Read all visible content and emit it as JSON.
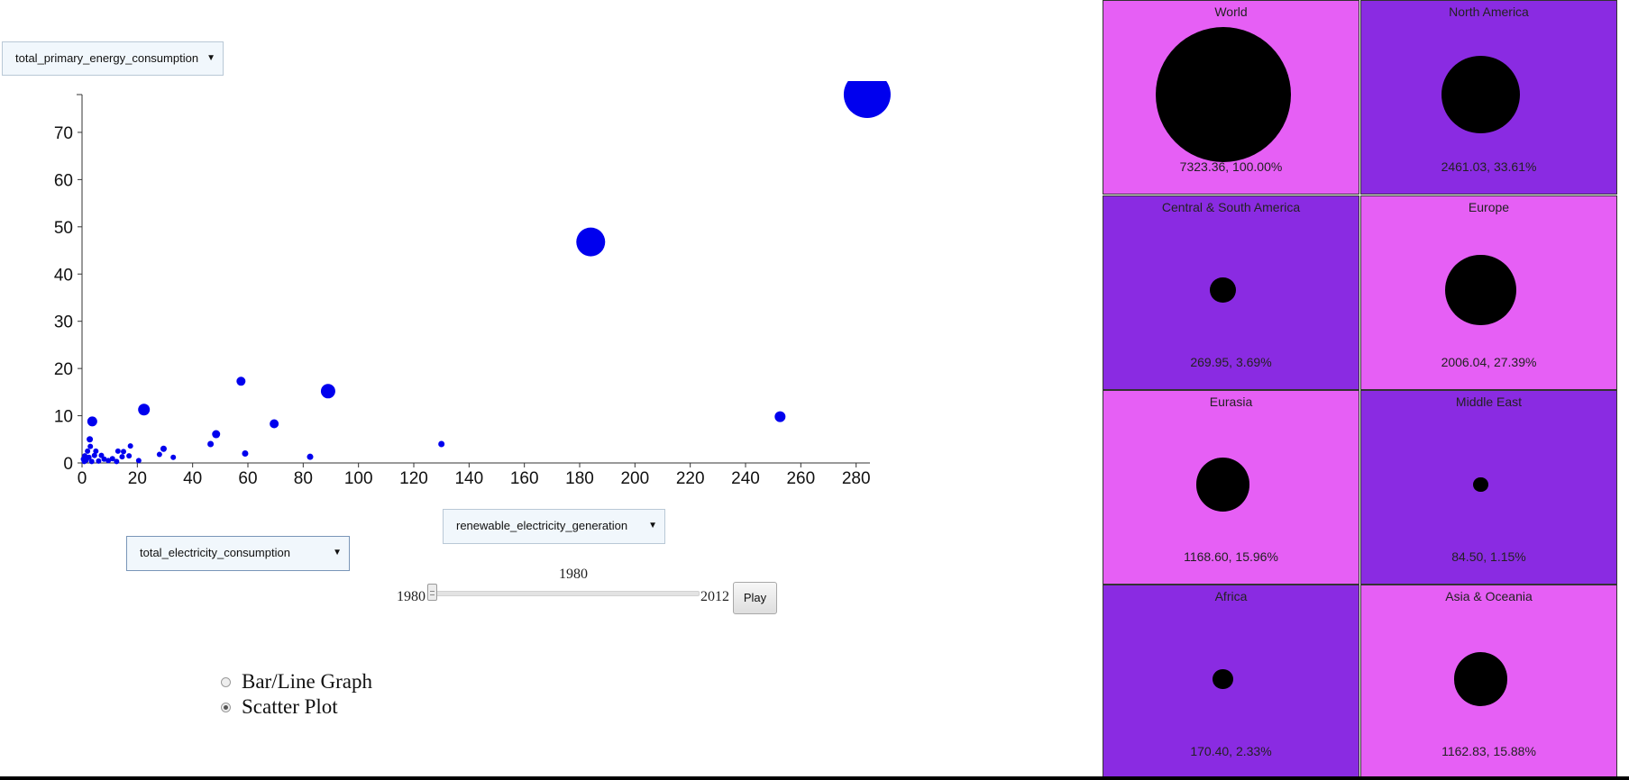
{
  "controls": {
    "y_select": "total_primary_energy_consumption",
    "size_select": "renewable_electricity_generation",
    "x_select": "total_electricity_consumption",
    "year_current": "1980",
    "year_min": "1980",
    "year_max": "2012",
    "play_label": "Play",
    "radio_bar_label": "Bar/Line Graph",
    "radio_scatter_label": "Scatter Plot",
    "selected_view": "scatter"
  },
  "chart_data": {
    "type": "scatter",
    "title": "",
    "xlabel": "",
    "ylabel": "",
    "xlim": [
      0,
      285
    ],
    "ylim": [
      0,
      78
    ],
    "xticks": [
      0,
      20,
      40,
      60,
      80,
      100,
      120,
      140,
      160,
      180,
      200,
      220,
      240,
      260,
      280
    ],
    "yticks": [
      0,
      10,
      20,
      30,
      40,
      50,
      60,
      70
    ],
    "grid": false,
    "point_color": "#0000ee",
    "points": [
      {
        "x": 284,
        "y": 78,
        "size": 26
      },
      {
        "x": 184,
        "y": 46.8,
        "size": 16
      },
      {
        "x": 252.5,
        "y": 9.8,
        "size": 6
      },
      {
        "x": 89,
        "y": 15.2,
        "size": 8
      },
      {
        "x": 57.5,
        "y": 17.3,
        "size": 5
      },
      {
        "x": 22.4,
        "y": 11.3,
        "size": 6.5
      },
      {
        "x": 69.5,
        "y": 8.3,
        "size": 5
      },
      {
        "x": 3.7,
        "y": 8.8,
        "size": 5.5
      },
      {
        "x": 48.5,
        "y": 6.1,
        "size": 4.5
      },
      {
        "x": 46.5,
        "y": 4,
        "size": 3.5
      },
      {
        "x": 130,
        "y": 4,
        "size": 3.5
      },
      {
        "x": 59,
        "y": 2,
        "size": 3.5
      },
      {
        "x": 82.5,
        "y": 1.3,
        "size": 3.5
      },
      {
        "x": 29.5,
        "y": 3,
        "size": 3.5
      },
      {
        "x": 28,
        "y": 1.8,
        "size": 3
      },
      {
        "x": 33,
        "y": 1.2,
        "size": 3
      },
      {
        "x": 17.5,
        "y": 3.6,
        "size": 3
      },
      {
        "x": 17,
        "y": 1.5,
        "size": 3
      },
      {
        "x": 13,
        "y": 2.5,
        "size": 3
      },
      {
        "x": 14.5,
        "y": 1.3,
        "size": 3
      },
      {
        "x": 11,
        "y": 0.9,
        "size": 3
      },
      {
        "x": 9.5,
        "y": 0.5,
        "size": 3
      },
      {
        "x": 8,
        "y": 0.8,
        "size": 3
      },
      {
        "x": 6,
        "y": 0.4,
        "size": 3
      },
      {
        "x": 5,
        "y": 2.5,
        "size": 3
      },
      {
        "x": 4.5,
        "y": 1.6,
        "size": 3
      },
      {
        "x": 3,
        "y": 3.5,
        "size": 3
      },
      {
        "x": 2.8,
        "y": 5,
        "size": 3.5
      },
      {
        "x": 2.5,
        "y": 1.2,
        "size": 3
      },
      {
        "x": 2,
        "y": 2.5,
        "size": 3
      },
      {
        "x": 1.5,
        "y": 0.6,
        "size": 3
      },
      {
        "x": 1,
        "y": 1.5,
        "size": 3
      },
      {
        "x": 0.8,
        "y": 0.3,
        "size": 3
      },
      {
        "x": 0.5,
        "y": 0.8,
        "size": 3
      },
      {
        "x": 3.5,
        "y": 0.3,
        "size": 3
      },
      {
        "x": 12.5,
        "y": 0.3,
        "size": 3
      },
      {
        "x": 20.5,
        "y": 0.5,
        "size": 3
      },
      {
        "x": 7,
        "y": 1.6,
        "size": 3
      },
      {
        "x": 15,
        "y": 2.4,
        "size": 3
      }
    ]
  },
  "regions": {
    "max_radius": 75,
    "items": [
      {
        "name": "World",
        "value_text": "7323.36, 100.00%",
        "fraction": 1.0,
        "bg": "#e65ff5"
      },
      {
        "name": "North America",
        "value_text": "2461.03, 33.61%",
        "fraction": 0.3361,
        "bg": "#8a2be2"
      },
      {
        "name": "Central & South America",
        "value_text": "269.95, 3.69%",
        "fraction": 0.0369,
        "bg": "#8a2be2"
      },
      {
        "name": "Europe",
        "value_text": "2006.04, 27.39%",
        "fraction": 0.2739,
        "bg": "#e65ff5"
      },
      {
        "name": "Eurasia",
        "value_text": "1168.60, 15.96%",
        "fraction": 0.1596,
        "bg": "#e65ff5"
      },
      {
        "name": "Middle East",
        "value_text": "84.50, 1.15%",
        "fraction": 0.0115,
        "bg": "#8a2be2"
      },
      {
        "name": "Africa",
        "value_text": "170.40, 2.33%",
        "fraction": 0.0233,
        "bg": "#8a2be2"
      },
      {
        "name": "Asia & Oceania",
        "value_text": "1162.83, 15.88%",
        "fraction": 0.1588,
        "bg": "#e65ff5"
      }
    ]
  }
}
